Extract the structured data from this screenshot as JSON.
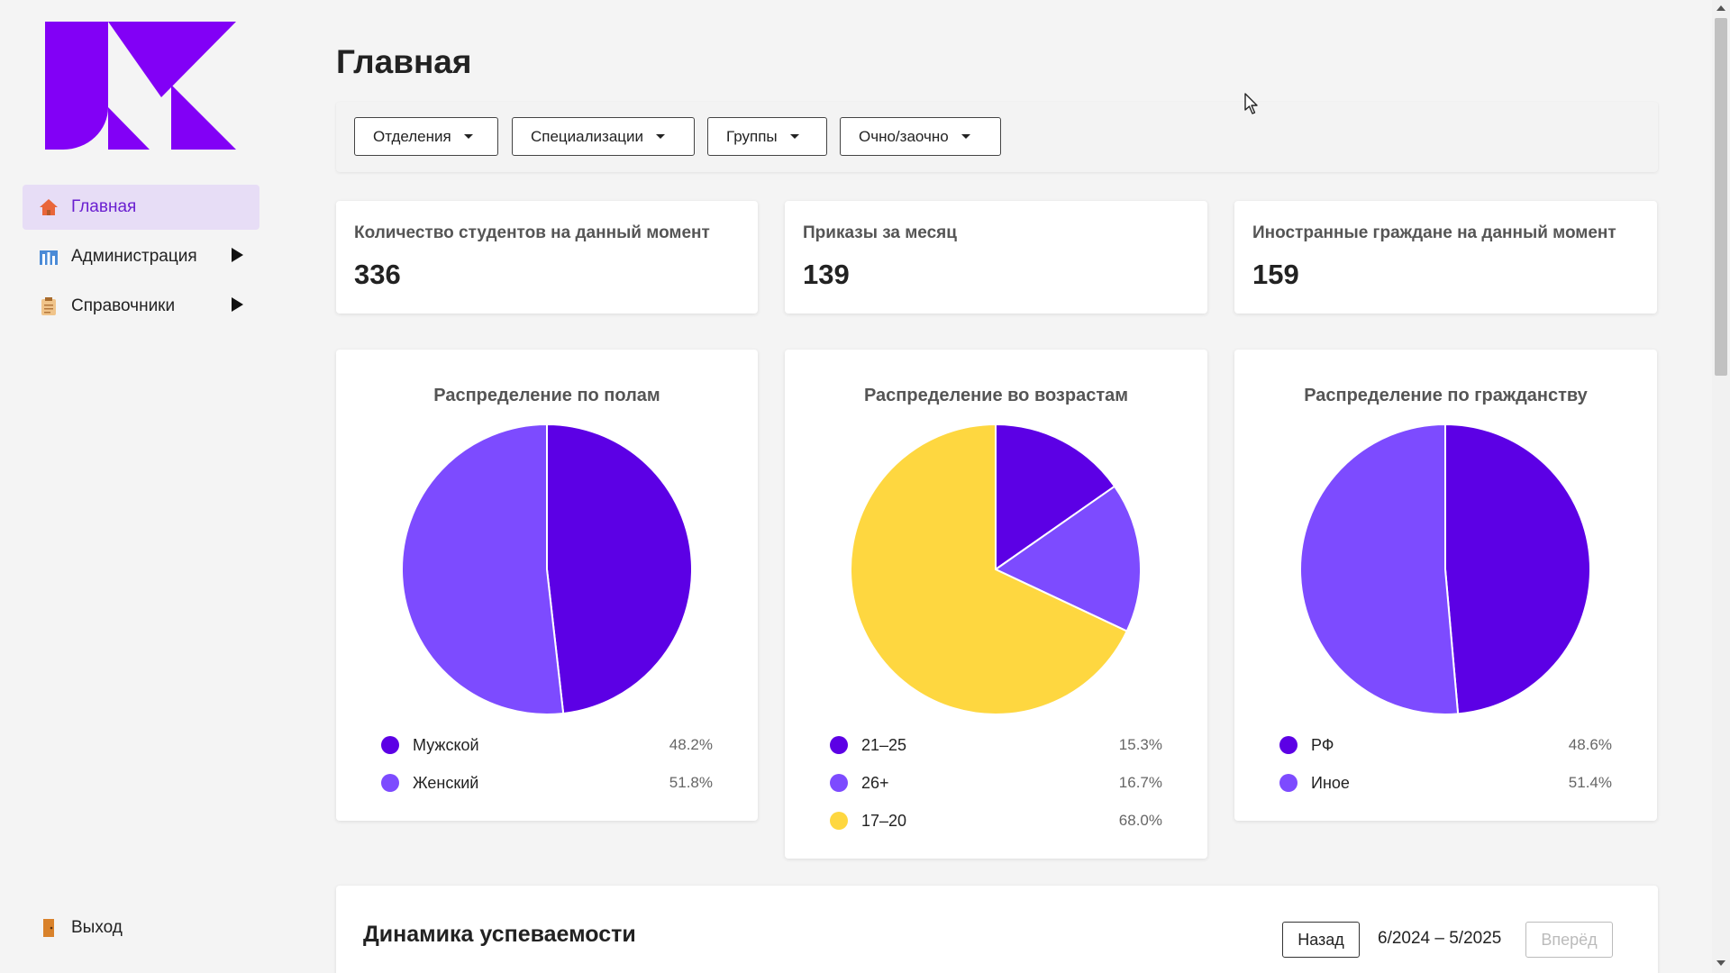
{
  "sidebar": {
    "logo": "logo-k",
    "items": [
      {
        "label": "Главная",
        "icon": "home-icon",
        "active": true
      },
      {
        "label": "Администрация",
        "icon": "administration-icon",
        "has_submenu": true
      },
      {
        "label": "Справочники",
        "icon": "reference-icon",
        "has_submenu": true
      }
    ],
    "logout_label": "Выход"
  },
  "header": {
    "title": "Главная"
  },
  "filters": [
    {
      "label": "Отделения"
    },
    {
      "label": "Специализации"
    },
    {
      "label": "Группы"
    },
    {
      "label": "Очно/заочно"
    }
  ],
  "stats": [
    {
      "label": "Количество студентов на данный момент",
      "value": "336"
    },
    {
      "label": "Приказы за месяц",
      "value": "139"
    },
    {
      "label": "Иностранные граждане на данный момент",
      "value": "159"
    }
  ],
  "colors": {
    "accent": "#6a1fd0",
    "dark_purple": "#5c00e5",
    "light_purple": "#7d4bff",
    "yellow": "#fed740"
  },
  "chart_data": [
    {
      "type": "pie",
      "title": "Распределение по полам",
      "categories": [
        "Мужской",
        "Женский"
      ],
      "values": [
        48.2,
        51.8
      ],
      "labels": [
        "48.2%",
        "51.8%"
      ],
      "colors": [
        "#5c00e5",
        "#7d4bff"
      ]
    },
    {
      "type": "pie",
      "title": "Распределение во возрастам",
      "categories": [
        "21–25",
        "26+",
        "17–20"
      ],
      "values": [
        15.3,
        16.7,
        68.0
      ],
      "labels": [
        "15.3%",
        "16.7%",
        "68.0%"
      ],
      "colors": [
        "#5c00e5",
        "#7d4bff",
        "#fed740"
      ]
    },
    {
      "type": "pie",
      "title": "Распределение по гражданству",
      "categories": [
        "РФ",
        "Иное"
      ],
      "values": [
        48.6,
        51.4
      ],
      "labels": [
        "48.6%",
        "51.4%"
      ],
      "colors": [
        "#5c00e5",
        "#7d4bff"
      ]
    }
  ],
  "performance": {
    "title": "Динамика успеваемости",
    "back_label": "Назад",
    "period": "6/2024 – 5/2025",
    "forward_label": "Вперёд"
  }
}
